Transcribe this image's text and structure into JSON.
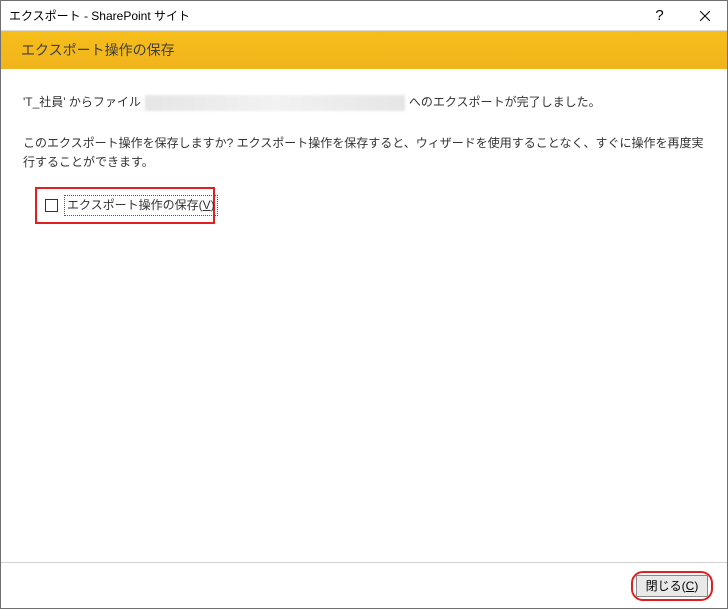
{
  "window": {
    "title": "エクスポート - SharePoint サイト"
  },
  "banner": {
    "title": "エクスポート操作の保存"
  },
  "content": {
    "line1_prefix": "'T_社員' からファイル",
    "line1_suffix": "へのエクスポートが完了しました。",
    "line2": "このエクスポート操作を保存しますか? エクスポート操作を保存すると、ウィザードを使用することなく、すぐに操作を再度実行することができます。",
    "checkbox_label": "エクスポート操作の保存(",
    "checkbox_accel": "V",
    "checkbox_label_end": ")"
  },
  "footer": {
    "close_label": "閉じる(",
    "close_accel": "C",
    "close_label_end": ")"
  }
}
